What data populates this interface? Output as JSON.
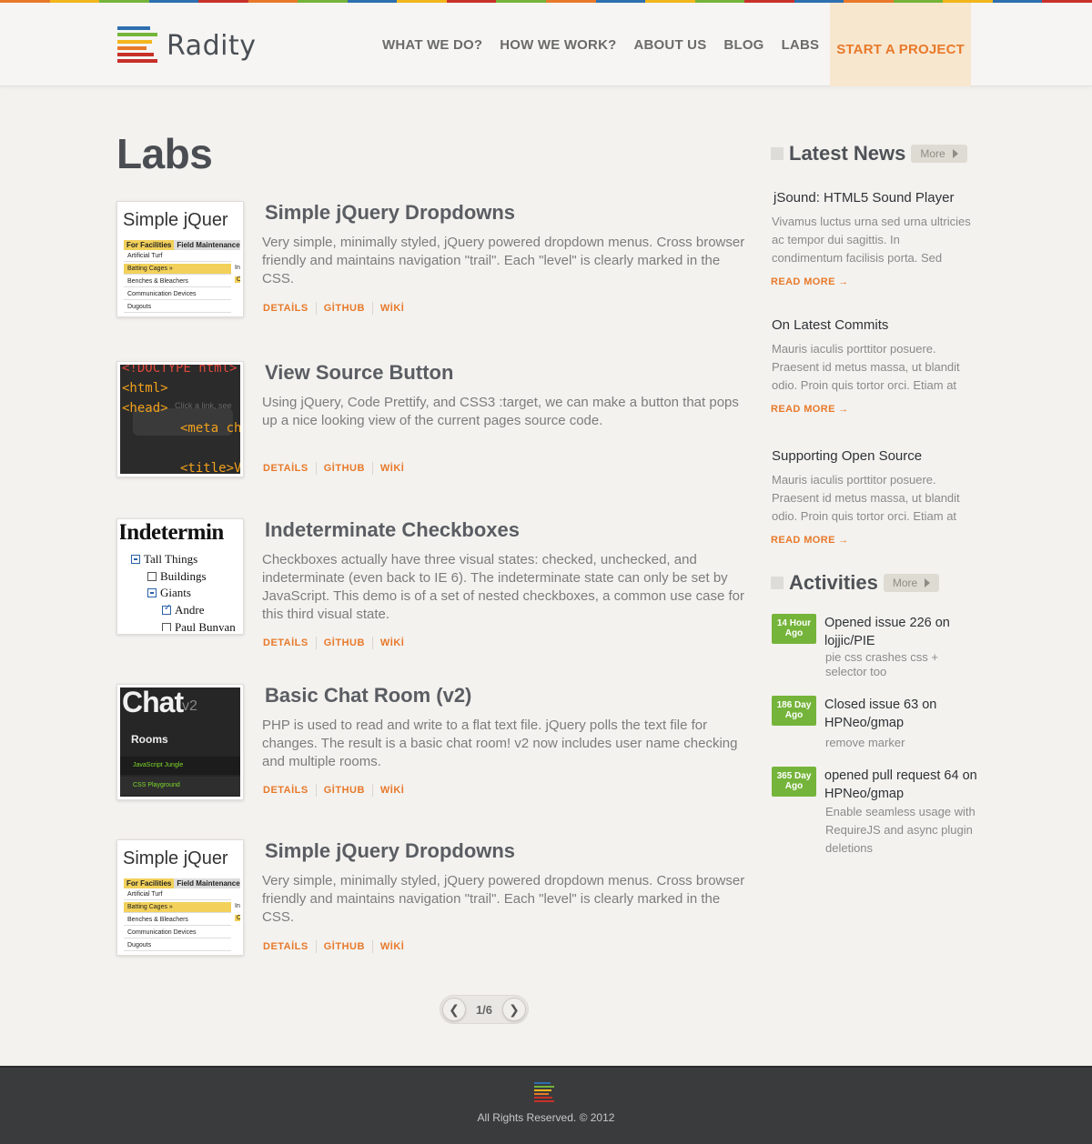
{
  "colors": {
    "accent": "#e8792a",
    "activity_badge": "#75b43a",
    "rainbow": [
      "#e8792a",
      "#f2b51c",
      "#75b43a",
      "#2e6fb0",
      "#c8302a",
      "#e8792a",
      "#75b43a",
      "#2e6fb0",
      "#f2b51c",
      "#c8302a",
      "#75b43a",
      "#e8792a",
      "#2e6fb0",
      "#f2b51c",
      "#75b43a",
      "#c8302a",
      "#2e6fb0",
      "#e8792a",
      "#75b43a",
      "#f2b51c",
      "#2e6fb0",
      "#c8302a"
    ]
  },
  "brand": {
    "name": "Radity"
  },
  "nav": {
    "items": [
      "WHAT WE DO?",
      "HOW WE WORK?",
      "ABOUT US",
      "BLOG",
      "LABS"
    ],
    "cta": "START A PROJECT"
  },
  "page": {
    "title": "Labs"
  },
  "labs": [
    {
      "title": "Simple jQuery Dropdowns",
      "description": "Very simple, minimally styled, jQuery powered dropdown menus. Cross browser friendly and maintains navigation \"trail\". Each \"level\" is clearly marked in the CSS.",
      "links": [
        "DETAİLS",
        "GİTHUB",
        "WİKİ"
      ],
      "thumb": {
        "heading": "Simple jQuer",
        "menu": [
          "For Facilities",
          "Field Maintenance"
        ],
        "rows": [
          "Artificial Turf",
          "Batting Cages »",
          "Benches & Bleachers",
          "Communication Devices",
          "Dugouts"
        ],
        "side_marks": [
          "In",
          "O"
        ]
      }
    },
    {
      "title": "View Source Button",
      "description": "Using jQuery, Code Prettify, and CSS3 :target, we can make a button that pops up a nice looking view of the current pages source code.",
      "links": [
        "DETAİLS",
        "GİTHUB",
        "WİKİ"
      ],
      "thumb": {
        "lines": [
          "<!DOCTYPE html>",
          "<html>",
          "<head>",
          "<meta cha",
          "<title>Vi"
        ],
        "overlay": "Click a link, see"
      }
    },
    {
      "title": "Indeterminate Checkboxes",
      "description": "Checkboxes actually have three visual states: checked, unchecked, and indeterminate (even back to IE 6). The indeterminate state can only be set by JavaScript. This demo is of a set of nested checkboxes, a common use case for this third visual state.",
      "links": [
        "DETAİLS",
        "GİTHUB",
        "WİKİ"
      ],
      "thumb": {
        "heading": "Indetermin",
        "items": [
          "Tall Things",
          "Buildings",
          "Giants",
          "Andre",
          "Paul Bunyan"
        ]
      }
    },
    {
      "title": "Basic Chat Room (v2)",
      "description": "PHP is used to read and write to a flat text file. jQuery polls the text file for changes. The result is a basic chat room! v2 now includes user name checking and multiple rooms.",
      "links": [
        "DETAİLS",
        "GİTHUB",
        "WİKİ"
      ],
      "thumb": {
        "heading": "Chat",
        "version": "v2",
        "rooms_label": "Rooms",
        "rooms": [
          "JavaScript Jungle",
          "CSS Playground"
        ]
      }
    },
    {
      "title": "Simple jQuery Dropdowns",
      "description": "Very simple, minimally styled, jQuery powered dropdown menus. Cross browser friendly and maintains navigation \"trail\". Each \"level\" is clearly marked in the CSS.",
      "links": [
        "DETAİLS",
        "GİTHUB",
        "WİKİ"
      ],
      "thumb": {
        "heading": "Simple jQuer",
        "menu": [
          "For Facilities",
          "Field Maintenance"
        ],
        "rows": [
          "Artificial Turf",
          "Batting Cages »",
          "Benches & Bleachers",
          "Communication Devices",
          "Dugouts"
        ],
        "side_marks": [
          "In",
          "O"
        ]
      }
    }
  ],
  "pagination": {
    "label": "1/6",
    "prev_icon": "chevron-left-icon",
    "next_icon": "chevron-right-icon"
  },
  "sidebar": {
    "news_heading": "Latest News",
    "more_label": "More",
    "news": [
      {
        "title": "jSound: HTML5 Sound Player",
        "body": "Vivamus luctus urna sed urna ultricies ac tempor dui sagittis. In condimentum facilisis porta. Sed",
        "more": "READ MORE →"
      },
      {
        "title": "On Latest Commits",
        "body": "Mauris iaculis porttitor posuere. Praesent id metus massa, ut blandit odio. Proin quis tortor orci. Etiam at",
        "more": "READ MORE →"
      },
      {
        "title": "Supporting Open Source",
        "body": "Mauris iaculis porttitor posuere. Praesent id metus massa, ut blandit odio. Proin quis tortor orci. Etiam at",
        "more": "READ MORE →"
      }
    ],
    "activities_heading": "Activities",
    "activities": [
      {
        "badge_top": "14 Hour",
        "badge_bottom": "Ago",
        "text": "Opened issue 226 on lojjic/PIE",
        "sub": "pie css crashes css + selector too"
      },
      {
        "badge_top": "186 Day",
        "badge_bottom": "Ago",
        "text": "Closed issue 63 on HPNeo/gmap",
        "sub": "remove marker"
      },
      {
        "badge_top": "365 Day",
        "badge_bottom": "Ago",
        "text": "opened pull request 64 on HPNeo/gmap",
        "sub": "Enable seamless usage with RequireJS and async plugin deletions"
      }
    ]
  },
  "footer": {
    "copyright": "All Rights Reserved. © 2012"
  }
}
